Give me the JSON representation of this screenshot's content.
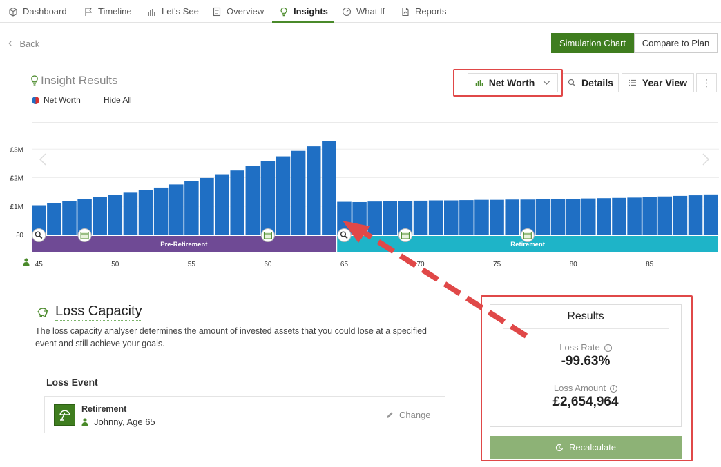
{
  "nav": {
    "tabs": [
      {
        "label": "Dashboard",
        "icon": "box-icon"
      },
      {
        "label": "Timeline",
        "icon": "flag-icon"
      },
      {
        "label": "Let's See",
        "icon": "bar-chart-icon"
      },
      {
        "label": "Overview",
        "icon": "document-icon"
      },
      {
        "label": "Insights",
        "icon": "lightbulb-icon",
        "active": true
      },
      {
        "label": "What If",
        "icon": "gauge-icon"
      },
      {
        "label": "Reports",
        "icon": "pdf-icon"
      }
    ]
  },
  "back_label": "Back",
  "view_toggle": {
    "simulation": "Simulation Chart",
    "compare": "Compare to Plan"
  },
  "insight": {
    "title": "Insight Results",
    "legend_label": "Net Worth",
    "hide_all": "Hide All",
    "chart_selector": "Net Worth",
    "details": "Details",
    "year_view": "Year View",
    "more": "⋮"
  },
  "chart_data": {
    "type": "bar",
    "ylabels": [
      "£3M",
      "£2M",
      "£1M",
      "£0"
    ],
    "yticks": [
      3,
      2,
      1,
      0
    ],
    "ylim": [
      0,
      3.2
    ],
    "x": [
      45,
      46,
      47,
      48,
      49,
      50,
      51,
      52,
      53,
      54,
      55,
      56,
      57,
      58,
      59,
      60,
      61,
      62,
      63,
      64,
      65,
      66,
      67,
      68,
      69,
      70,
      71,
      72,
      73,
      74,
      75,
      76,
      77,
      78,
      79,
      80,
      81,
      82,
      83,
      84,
      85,
      86,
      87,
      88,
      89
    ],
    "values": [
      1.03,
      1.1,
      1.17,
      1.24,
      1.31,
      1.39,
      1.47,
      1.56,
      1.65,
      1.76,
      1.87,
      1.99,
      2.12,
      2.25,
      2.41,
      2.57,
      2.75,
      2.94,
      3.1,
      3.28,
      1.15,
      1.14,
      1.16,
      1.18,
      1.18,
      1.19,
      1.2,
      1.2,
      1.21,
      1.22,
      1.22,
      1.23,
      1.23,
      1.24,
      1.25,
      1.26,
      1.27,
      1.28,
      1.29,
      1.3,
      1.32,
      1.34,
      1.36,
      1.38,
      1.41
    ],
    "xlabels": [
      45,
      50,
      55,
      60,
      65,
      70,
      75,
      80,
      85
    ],
    "color": "#1f6fc4",
    "phases": [
      {
        "label": "Pre-Retirement",
        "from": 45,
        "to": 64,
        "color": "#6f4a95"
      },
      {
        "label": "Retirement",
        "from": 65,
        "to": 89,
        "color": "#1eb4c8"
      }
    ],
    "markers": [
      {
        "age": 45,
        "icon": "zoom-icon"
      },
      {
        "age": 48,
        "icon": "calendar-icon"
      },
      {
        "age": 60,
        "icon": "calendar-icon"
      },
      {
        "age": 65,
        "icon": "zoom-icon"
      },
      {
        "age": 69,
        "icon": "calendar-icon"
      },
      {
        "age": 77,
        "icon": "calendar-icon"
      }
    ]
  },
  "loss_capacity": {
    "title": "Loss Capacity",
    "description": "The loss capacity analyser determines the amount of invested assets that you could lose at a specified event and still achieve your goals.",
    "event_label": "Loss Event",
    "event": {
      "title": "Retirement",
      "person": "Johnny, Age 65",
      "change": "Change"
    }
  },
  "results": {
    "title": "Results",
    "loss_rate_label": "Loss Rate",
    "loss_rate": "-99.63%",
    "loss_amount_label": "Loss Amount",
    "loss_amount": "£2,654,964",
    "recalculate": "Recalculate"
  },
  "colors": {
    "accent": "#3f7d1f",
    "highlight": "#e04848",
    "bar": "#1f6fc4"
  }
}
